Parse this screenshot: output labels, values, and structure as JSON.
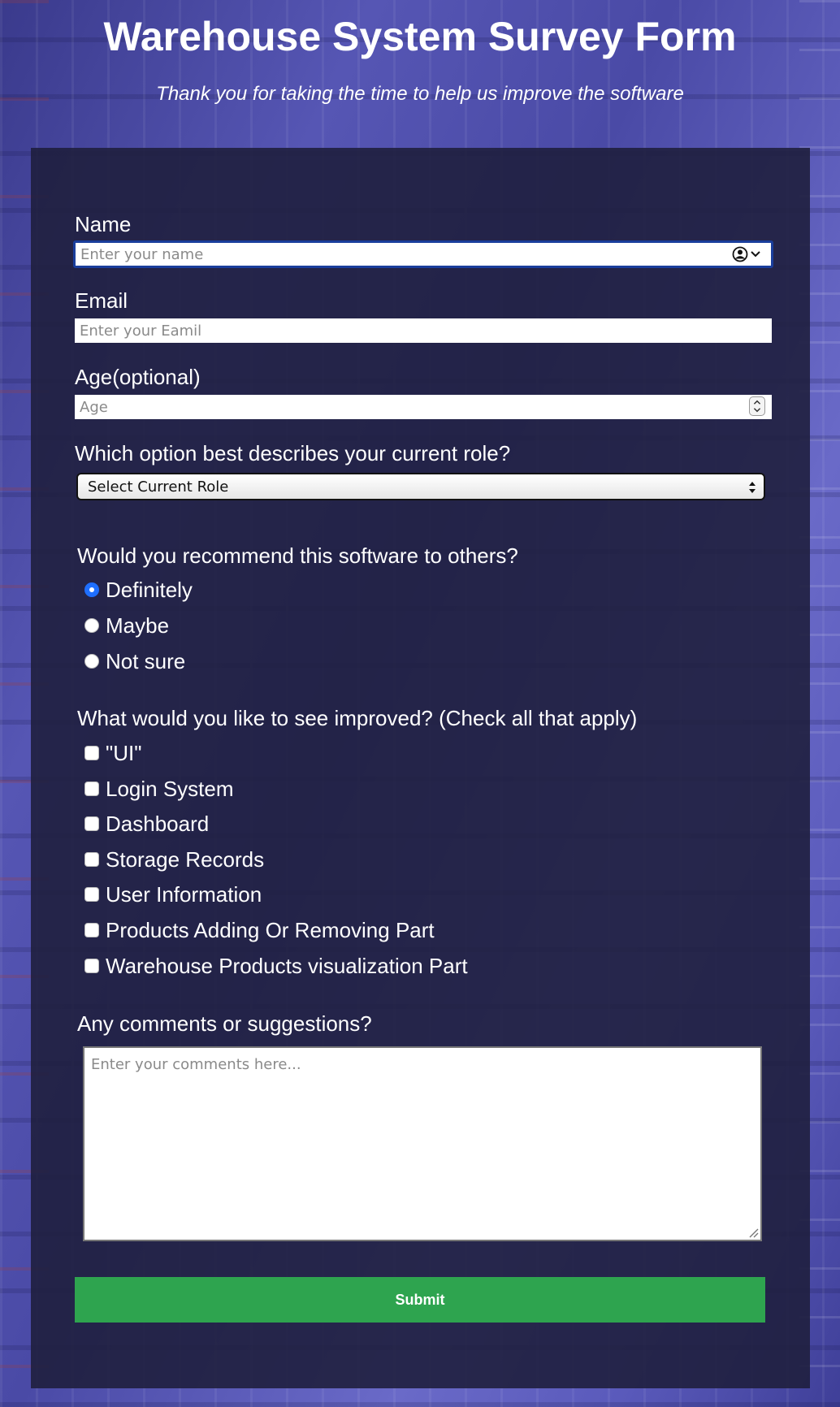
{
  "header": {
    "title": "Warehouse System Survey Form",
    "subtitle": "Thank you for taking the time to help us improve the software"
  },
  "form": {
    "name": {
      "label": "Name",
      "value": "",
      "placeholder": "Enter your name",
      "icon": "person-autofill-icon"
    },
    "email": {
      "label": "Email",
      "value": "",
      "placeholder": "Enter your Eamil"
    },
    "age": {
      "label": "Age(optional)",
      "value": "",
      "placeholder": "Age"
    },
    "role": {
      "label": "Which option best describes your current role?",
      "selected": "Select Current Role"
    },
    "recommend": {
      "label": "Would you recommend this software to others?",
      "options": [
        {
          "label": "Definitely",
          "checked": true
        },
        {
          "label": "Maybe",
          "checked": false
        },
        {
          "label": "Not sure",
          "checked": false
        }
      ]
    },
    "improve": {
      "label": "What would you like to see improved? (Check all that apply)",
      "options": [
        {
          "label": "\"UI\"",
          "checked": false
        },
        {
          "label": "Login System",
          "checked": false
        },
        {
          "label": "Dashboard",
          "checked": false
        },
        {
          "label": "Storage Records",
          "checked": false
        },
        {
          "label": "User Information",
          "checked": false
        },
        {
          "label": "Products Adding Or Removing Part",
          "checked": false
        },
        {
          "label": "Warehouse Products visualization Part",
          "checked": false
        }
      ]
    },
    "comments": {
      "label": "Any comments or suggestions?",
      "value": "",
      "placeholder": "Enter your comments here..."
    },
    "submit_label": "Submit"
  },
  "colors": {
    "panel_background": "#1f1f3e",
    "submit_button": "#2ea44f",
    "radio_selected": "#1f6fff",
    "focus_border": "#1a3e9c"
  }
}
